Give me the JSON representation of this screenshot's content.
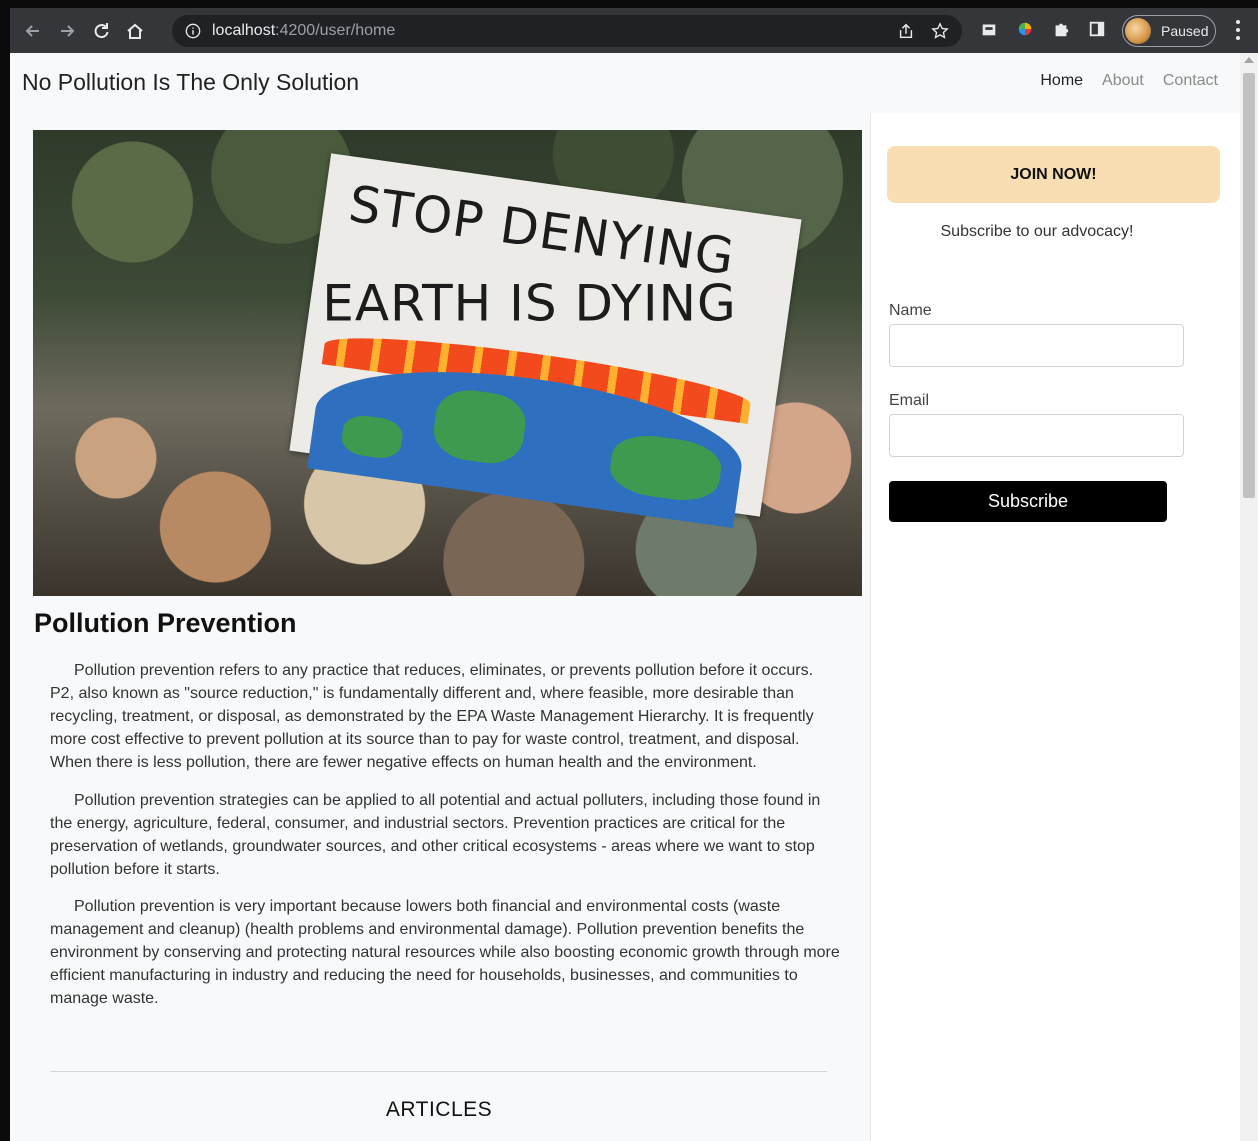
{
  "browser": {
    "url_host": "localhost",
    "url_path": ":4200/user/home",
    "profile_status": "Paused"
  },
  "header": {
    "brand": "No Pollution Is The Only Solution",
    "nav": [
      "Home",
      "About",
      "Contact"
    ]
  },
  "hero": {
    "sign_line1": "STOP DENYING",
    "sign_line2": "EARTH IS DYING"
  },
  "main": {
    "title": "Pollution Prevention",
    "paragraphs": [
      "Pollution prevention refers to any practice that reduces, eliminates, or prevents pollution before it occurs. P2, also known as \"source reduction,\" is fundamentally different and, where feasible, more desirable than recycling, treatment, or disposal, as demonstrated by the EPA Waste Management Hierarchy. It is frequently more cost effective to prevent pollution at its source than to pay for waste control, treatment, and disposal. When there is less pollution, there are fewer negative effects on human health and the environment.",
      "Pollution prevention strategies can be applied to all potential and actual polluters, including those found in the energy, agriculture, federal, consumer, and industrial sectors. Prevention practices are critical for the preservation of wetlands, groundwater sources, and other critical ecosystems - areas where we want to stop pollution before it starts.",
      "Pollution prevention is very important because lowers both financial and environmental costs (waste management and cleanup) (health problems and environmental damage). Pollution prevention benefits the environment by conserving and protecting natural resources while also boosting economic growth through more efficient manufacturing in industry and reducing the need for households, businesses, and communities to manage waste."
    ],
    "articles_heading": "ARTICLES"
  },
  "sidebar": {
    "join_label": "JOIN NOW!",
    "subscribe_note": "Subscribe to our advocacy!",
    "name_label": "Name",
    "name_value": "",
    "email_label": "Email",
    "email_value": "",
    "subscribe_label": "Subscribe"
  },
  "colors": {
    "join_bg": "#f9deb4",
    "subscribe_bg": "#000000",
    "chrome_bg": "#35363a"
  }
}
